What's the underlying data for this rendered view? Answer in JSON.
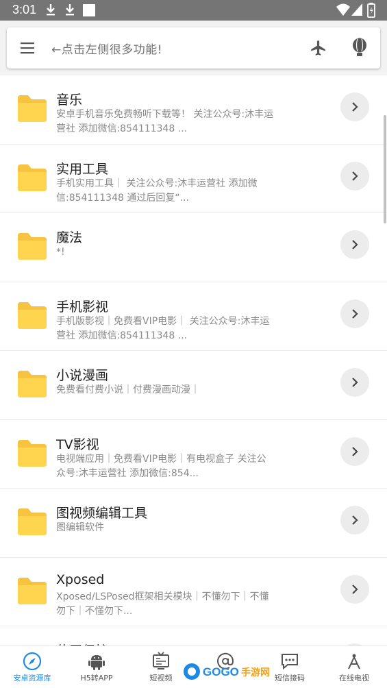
{
  "status_bar": {
    "time": "3:01"
  },
  "search": {
    "hint": "←点击左侧很多功能!"
  },
  "items": [
    {
      "title": "音乐",
      "desc": "安卓手机音乐免费畅听下载等！ 关注公众号:沐丰运营社 添加微信:854111348 ..."
    },
    {
      "title": "实用工具",
      "desc": "手机实用工具｜ 关注公众号:沐丰运营社 添加微信:854111348 通过后回复“..."
    },
    {
      "title": "魔法",
      "desc": "*!"
    },
    {
      "title": "手机影视",
      "desc": "手机版影视｜免费看VIP电影｜ 关注公众号:沐丰运营社 添加微信:854111348 ..."
    },
    {
      "title": "小说漫画",
      "desc": "免费看付费小说｜付费漫画动漫｜"
    },
    {
      "title": "TV影视",
      "desc": "电视端应用｜免费看VIP电影｜有电视盒子 关注公众号:沐丰运营社 添加微信:854..."
    },
    {
      "title": "图视频编辑工具",
      "desc": "图编辑软件"
    },
    {
      "title": "Xposed",
      "desc": "Xposed/LSPosed框架相关模块｜不懂勿下｜不懂勿下｜不懂勿下..."
    },
    {
      "title": "位置保护",
      "desc": ""
    }
  ],
  "bottom_nav": [
    {
      "label": "安卓资源库",
      "icon": "compass-icon",
      "active": true
    },
    {
      "label": "H5转APP",
      "icon": "android-icon",
      "active": false
    },
    {
      "label": "短视频",
      "icon": "tv-icon",
      "active": false
    },
    {
      "label": "",
      "icon": "at-icon",
      "active": false
    },
    {
      "label": "短信接码",
      "icon": "message-icon",
      "active": false
    },
    {
      "label": "在线电视",
      "icon": "antenna-icon",
      "active": false
    }
  ],
  "watermark": {
    "text": "GOGO手游网",
    "url": "WWW.GOGO.CN"
  },
  "colors": {
    "accent": "#1e88e5",
    "folder": "#ffd54f",
    "status_bar": "#757575"
  }
}
